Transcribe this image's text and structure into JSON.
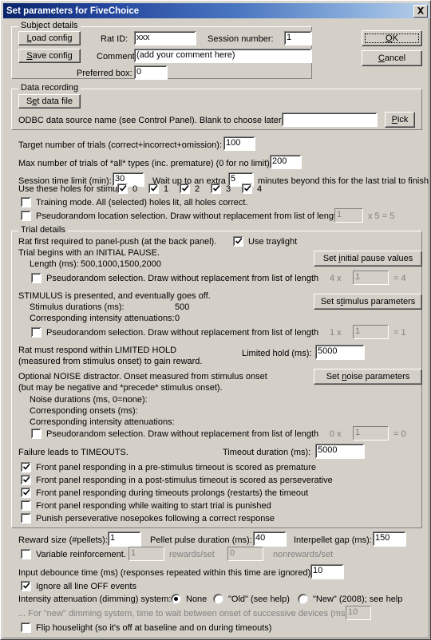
{
  "window": {
    "title": "Set parameters for FiveChoice",
    "close_label": "close-icon"
  },
  "actions": {
    "ok": "OK",
    "cancel": "Cancel"
  },
  "subject_details": {
    "legend": "Subject details",
    "load_config": "Load config",
    "save_config": "Save config",
    "rat_id_label": "Rat ID:",
    "rat_id_value": "xxx",
    "session_number_label": "Session number:",
    "session_number_value": "1",
    "comment_label": "Comment:",
    "comment_value": "(add your comment here)",
    "preferred_box_label": "Preferred box:",
    "preferred_box_value": "0"
  },
  "data_recording": {
    "legend": "Data recording",
    "set_data_file": "Set data file",
    "odbc_label": "ODBC data source name (see Control Panel). Blank to choose later:",
    "odbc_value": "",
    "pick": "Pick"
  },
  "trials": {
    "target_label": "Target number of trials (correct+incorrect+omission):",
    "target_value": "100",
    "max_label": "Max number of trials of *all* types (inc. premature) (0 for no limit):",
    "max_value": "200",
    "session_time_label": "Session time limit (min):",
    "session_time_value": "30",
    "wait_extra_label": "Wait up to an extra",
    "wait_extra_value": "5",
    "wait_extra_suffix": "minutes beyond this for the last trial to finish",
    "holes_label": "Use these holes for stimuli:",
    "holes": [
      {
        "label": "0",
        "checked": true
      },
      {
        "label": "1",
        "checked": true
      },
      {
        "label": "2",
        "checked": true
      },
      {
        "label": "3",
        "checked": true
      },
      {
        "label": "4",
        "checked": true
      }
    ],
    "training_mode_label": "Training mode. All (selected) holes lit, all holes correct.",
    "training_mode_checked": false,
    "pseudorandom_location_label": "Pseudorandom location selection. Draw without replacement from list of length",
    "pseudorandom_location_checked": false,
    "pseudorandom_location_value": "1",
    "pseudorandom_location_suffix": "x 5 = 5"
  },
  "trial_details": {
    "legend": "Trial details",
    "panel_push_label": "Rat first required to panel-push (at the back panel).",
    "use_traylight_label": "Use traylight",
    "use_traylight_checked": true,
    "initial_pause_label": "Trial begins with an INITIAL PAUSE.",
    "initial_pause_length_label": "Length (ms):",
    "initial_pause_length_value": "500,1000,1500,2000",
    "set_initial_pause_btn": "Set initial pause values",
    "pause_pseudo_label": "Pseudorandom selection. Draw without replacement from list of length",
    "pause_pseudo_checked": false,
    "pause_pseudo_prefix": "4 x",
    "pause_pseudo_value": "1",
    "pause_pseudo_suffix": "= 4",
    "stimulus_label": "STIMULUS is presented, and eventually goes off.",
    "stimulus_durations_label": "Stimulus durations (ms):",
    "stimulus_durations_value": "500",
    "stimulus_atten_label": "Corresponding intensity attenuations:",
    "stimulus_atten_value": "0",
    "set_stimulus_btn": "Set stimulus parameters",
    "stim_pseudo_label": "Pseudorandom selection. Draw without replacement from list of length",
    "stim_pseudo_checked": false,
    "stim_pseudo_prefix": "1 x",
    "stim_pseudo_value": "1",
    "stim_pseudo_suffix": "= 1",
    "limited_hold_line1": "Rat must respond within LIMITED HOLD",
    "limited_hold_line2": "(measured from stimulus onset) to gain reward.",
    "limited_hold_label": "Limited hold (ms):",
    "limited_hold_value": "5000",
    "noise_line1": "Optional NOISE distractor. Onset measured from stimulus onset",
    "noise_line2": "(but may be negative and *precede* stimulus onset).",
    "set_noise_btn": "Set noise parameters",
    "noise_durations_label": "Noise durations (ms, 0=none):",
    "noise_durations_value": "",
    "noise_onsets_label": "Corresponding onsets (ms):",
    "noise_onsets_value": "",
    "noise_atten_label": "Corresponding intensity attenuations:",
    "noise_atten_value": "",
    "noise_pseudo_label": "Pseudorandom selection. Draw without replacement from list of length",
    "noise_pseudo_checked": false,
    "noise_pseudo_prefix": "0 x",
    "noise_pseudo_value": "1",
    "noise_pseudo_suffix": "= 0",
    "timeouts_label": "Failure leads to TIMEOUTS.",
    "timeout_duration_label": "Timeout duration (ms):",
    "timeout_duration_value": "5000",
    "timeout_options": [
      {
        "label": "Front panel responding in a pre-stimulus timeout is scored as premature",
        "checked": true
      },
      {
        "label": "Front panel responding in a post-stimulus timeout is scored as perseverative",
        "checked": true
      },
      {
        "label": "Front panel responding during timeouts prolongs (restarts) the timeout",
        "checked": true
      },
      {
        "label": "Front panel responding while waiting to start trial is punished",
        "checked": false
      },
      {
        "label": "Punish perseverative nosepokes following a correct response",
        "checked": false
      }
    ]
  },
  "reward": {
    "reward_size_label": "Reward size (#pellets):",
    "reward_size_value": "1",
    "pellet_pulse_label": "Pellet pulse duration (ms):",
    "pellet_pulse_value": "40",
    "interpellet_label": "Interpellet gap (ms):",
    "interpellet_value": "150",
    "variable_reinf_label": "Variable reinforcement.",
    "variable_reinf_checked": false,
    "rewards_value": "1",
    "rewards_suffix": "rewards/set",
    "nonrewards_value": "0",
    "nonrewards_suffix": "nonrewards/set"
  },
  "misc": {
    "debounce_label": "Input debounce time (ms) (responses repeated within this time are ignored):",
    "debounce_value": "10",
    "ignore_off_label": "Ignore all line OFF events",
    "ignore_off_checked": true,
    "dimming_label": "Intensity attenuation (dimming) system:",
    "dimming_options": [
      {
        "label": "None",
        "selected": true
      },
      {
        "label": "\"Old\" (see help)",
        "selected": false
      },
      {
        "label": "\"New\" (2008); see help",
        "selected": false
      }
    ],
    "dimming_wait_label": "... For \"new\" dimming system, time to wait between onset of successive devices (ms):",
    "dimming_wait_value": "10",
    "flip_houselight_label": "Flip houselight (so it's off at baseline and on during timeouts)",
    "flip_houselight_checked": false
  },
  "colors": {
    "face": "#d4d0c8",
    "title_start": "#0a246a",
    "title_end": "#b9cfe8",
    "disabled_text": "#808080"
  }
}
